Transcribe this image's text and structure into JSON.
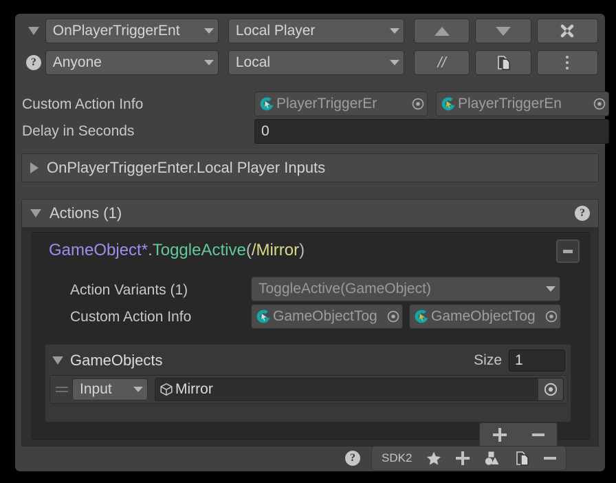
{
  "header": {
    "event_name": "OnPlayerTriggerEnt",
    "target_scope": "Local Player",
    "access": "Anyone",
    "network": "Local",
    "move_up_icon": "triangle-up-icon",
    "move_down_icon": "triangle-down-icon",
    "delete_icon": "close-x-icon",
    "comment_label": "//",
    "duplicate_icon": "copy-icon",
    "more_icon": "kebab-menu-icon",
    "help_icon": "help-circle-icon"
  },
  "custom_action_info": {
    "label": "Custom Action Info",
    "field_one": "PlayerTriggerEr",
    "field_two": "PlayerTriggerEn",
    "icon": "udon-cursor-icon",
    "picker_icon": "object-picker-icon"
  },
  "delay": {
    "label": "Delay in Seconds",
    "value": "0"
  },
  "inputs_foldout": {
    "label": "OnPlayerTriggerEnter.Local Player Inputs",
    "arrow_icon": "triangle-right-icon"
  },
  "actions": {
    "header_label": "Actions (1)",
    "arrow_icon": "triangle-down-icon",
    "help_icon": "help-circle-icon",
    "signature": {
      "type": "GameObject*",
      "dot": ".",
      "method": "ToggleActive",
      "open_paren": "(",
      "arg": "/Mirror",
      "close_paren": ")"
    },
    "collapse_icon": "minus-box-icon",
    "variants": {
      "label": "Action Variants (1)",
      "value": "ToggleActive(GameObject)"
    },
    "custom_action_info": {
      "label": "Custom Action Info",
      "field_one": "GameObjectTog",
      "field_two": "GameObjectTog",
      "icon": "udon-cursor-icon",
      "picker_icon": "object-picker-icon"
    },
    "gameobjects": {
      "label": "GameObjects",
      "arrow_icon": "triangle-down-icon",
      "size_label": "Size",
      "size_value": "1",
      "rows": [
        {
          "drag_icon": "drag-handle-icon",
          "source": "Input",
          "value": "Mirror",
          "value_icon": "prefab-cube-icon",
          "picker_icon": "object-picker-icon"
        }
      ],
      "add_icon": "plus-icon",
      "remove_icon": "minus-icon"
    }
  },
  "bottom_bar": {
    "help_icon": "help-circle-icon",
    "sdk_label": "SDK2",
    "favorite_icon": "star-icon",
    "add_icon": "plus-icon",
    "shapes_icon": "shapes-icon",
    "duplicate_icon": "copy-icon",
    "remove_icon": "minus-icon"
  },
  "colors": {
    "panel_bg": "#414141",
    "accent_teal": "#1aa4a4",
    "accent_gold": "#e3b23c",
    "type_purple": "#9b8ef0",
    "method_green": "#62c99a",
    "arg_yellow": "#d9dd86"
  }
}
